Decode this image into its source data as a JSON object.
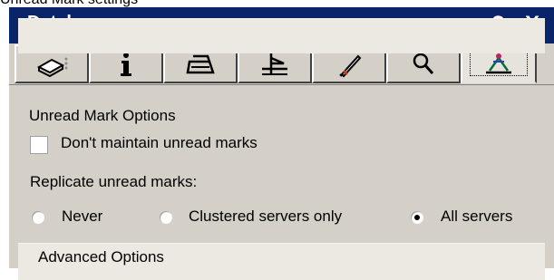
{
  "caption": "Unread Mark settings",
  "window": {
    "title": "Database",
    "controls": {
      "minimize_icon": "dash-icon",
      "help": "?",
      "close": "X"
    }
  },
  "tabs": [
    {
      "icon": "properties-icon"
    },
    {
      "icon": "info-icon"
    },
    {
      "icon": "printer-icon"
    },
    {
      "icon": "design-icon"
    },
    {
      "icon": "rocket-icon"
    },
    {
      "icon": "search-icon"
    },
    {
      "icon": "advanced-icon",
      "active": true
    }
  ],
  "unread": {
    "section_title": "Unread Mark Options",
    "dont_maintain_label": "Don't maintain unread marks",
    "dont_maintain_checked": false,
    "replicate_label": "Replicate unread marks:",
    "options": [
      {
        "label": "Never",
        "selected": false
      },
      {
        "label": "Clustered servers only",
        "selected": false
      },
      {
        "label": "All servers",
        "selected": true
      }
    ]
  },
  "advanced": {
    "section_title": "Advanced Options"
  }
}
